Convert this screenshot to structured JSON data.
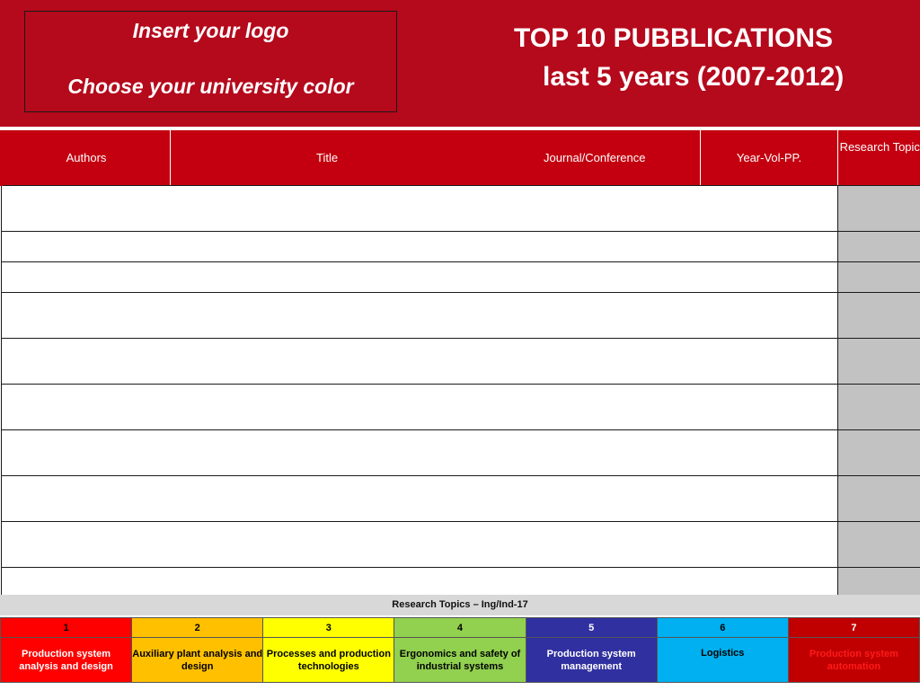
{
  "header": {
    "logo_line1": "Insert your logo",
    "logo_line2": "Choose your university color",
    "title_line1": "TOP 10 PUBBLICATIONS",
    "title_line2": "last 5 years (2007-2012)",
    "bg_color": "#b5091c"
  },
  "table": {
    "columns": [
      "Authors",
      "Title",
      "Journal/Conference",
      "Year-Vol-PP.",
      "Research Topic"
    ],
    "header_color": "#c40010",
    "topic_cell_color": "#c2c2c2",
    "row_count": 10
  },
  "legend": {
    "title": "Research Topics – Ing/Ind-17",
    "topics": [
      {
        "number": "1",
        "label": "Production system analysis and design",
        "color": "#ff0000",
        "text_color": "#ffffff"
      },
      {
        "number": "2",
        "label": "Auxiliary plant analysis and design",
        "color": "#ffc000",
        "text_color": "#000000"
      },
      {
        "number": "3",
        "label": "Processes and production technologies",
        "color": "#ffff00",
        "text_color": "#000000"
      },
      {
        "number": "4",
        "label": "Ergonomics and safety of industrial systems",
        "color": "#92d050",
        "text_color": "#000000"
      },
      {
        "number": "5",
        "label": "Production system management",
        "color": "#3030a0",
        "text_color": "#ffffff"
      },
      {
        "number": "6",
        "label": "Logistics",
        "color": "#00b0f0",
        "text_color": "#000000"
      },
      {
        "number": "7",
        "label": "Production system automation",
        "color": "#c00000",
        "text_color": "#ff0000"
      }
    ]
  }
}
